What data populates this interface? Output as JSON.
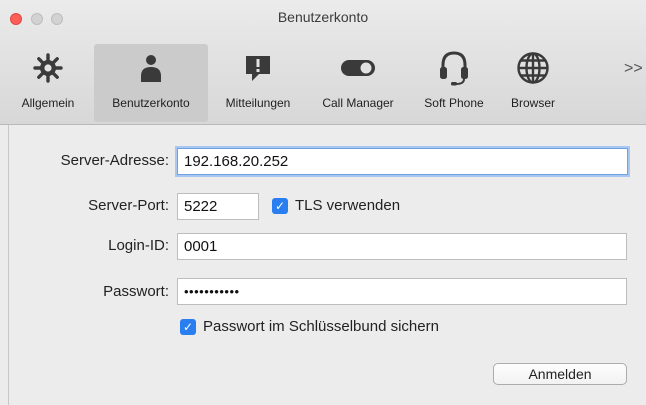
{
  "window": {
    "title": "Benutzerkonto"
  },
  "toolbar": {
    "items": [
      {
        "label": "Allgemein",
        "icon": "gear-icon"
      },
      {
        "label": "Benutzerkonto",
        "icon": "user-icon"
      },
      {
        "label": "Mitteilungen",
        "icon": "message-alert-icon"
      },
      {
        "label": "Call Manager",
        "icon": "toggle-icon"
      },
      {
        "label": "Soft Phone",
        "icon": "headset-icon"
      },
      {
        "label": "Browser",
        "icon": "globe-icon"
      }
    ],
    "selected": "Benutzerkonto",
    "overflow": ">>"
  },
  "form": {
    "server_address": {
      "label": "Server-Adresse:",
      "value": "192.168.20.252"
    },
    "server_port": {
      "label": "Server-Port:",
      "value": "5222"
    },
    "tls": {
      "label": "TLS verwenden",
      "checked": true
    },
    "login_id": {
      "label": "Login-ID:",
      "value": "0001"
    },
    "password": {
      "label": "Passwort:",
      "value": "•••••••••••"
    },
    "keychain": {
      "label": "Passwort im Schlüsselbund sichern",
      "checked": true
    },
    "login_button": {
      "label": "Anmelden"
    }
  },
  "colors": {
    "accent": "#2a7ff0",
    "close": "#fc5f57",
    "focus": "#6fa2e4"
  }
}
